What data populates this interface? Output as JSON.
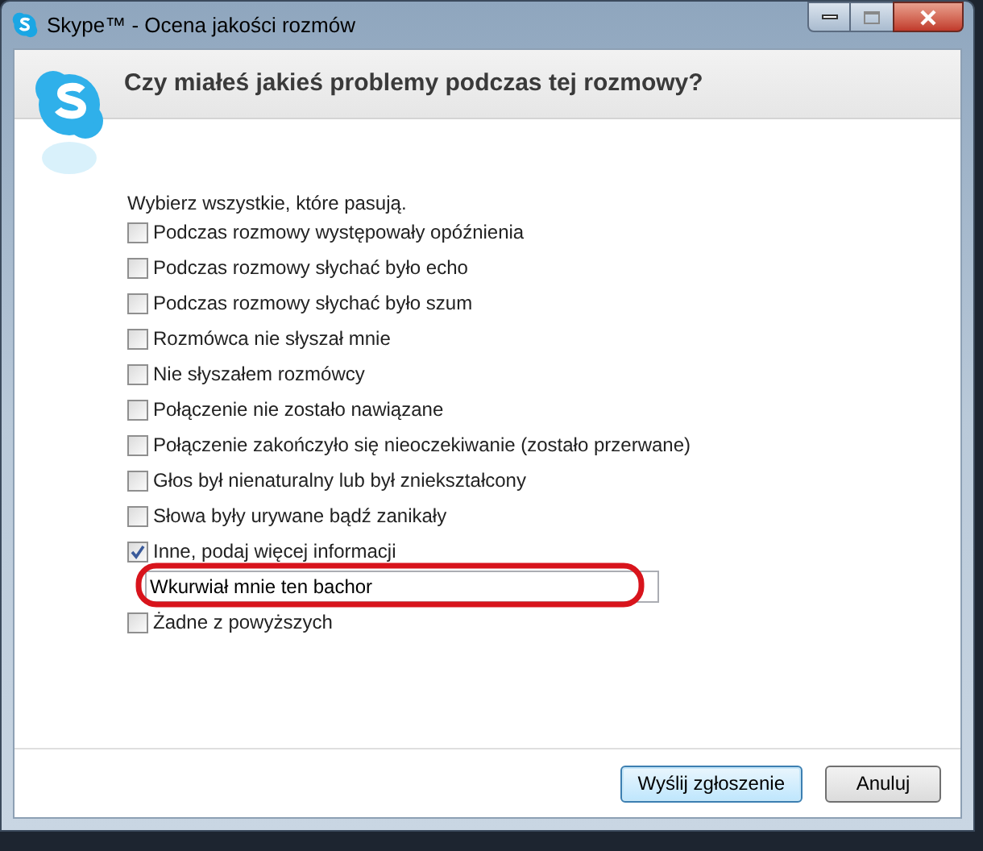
{
  "window": {
    "title": "Skype™ - Ocena jakości rozmów"
  },
  "heading": "Czy miałeś jakieś problemy podczas tej rozmowy?",
  "instruction": "Wybierz wszystkie, które pasują.",
  "options": [
    {
      "label": "Podczas rozmowy występowały opóźnienia",
      "checked": false
    },
    {
      "label": "Podczas rozmowy słychać było echo",
      "checked": false
    },
    {
      "label": "Podczas rozmowy słychać było szum",
      "checked": false
    },
    {
      "label": "Rozmówca nie słyszał mnie",
      "checked": false
    },
    {
      "label": "Nie słyszałem rozmówcy",
      "checked": false
    },
    {
      "label": "Połączenie nie zostało nawiązane",
      "checked": false
    },
    {
      "label": "Połączenie zakończyło się nieoczekiwanie (zostało przerwane)",
      "checked": false
    },
    {
      "label": "Głos był nienaturalny lub był zniekształcony",
      "checked": false
    },
    {
      "label": "Słowa były urywane bądź zanikały",
      "checked": false
    },
    {
      "label": "Inne, podaj więcej informacji",
      "checked": true,
      "details": {
        "value": "Wkurwiał mnie ten bachor"
      }
    },
    {
      "label": "Żadne z powyższych",
      "checked": false
    }
  ],
  "buttons": [
    {
      "label": "Wyślij zgłoszenie",
      "default": true
    },
    {
      "label": "Anuluj",
      "default": false
    }
  ]
}
